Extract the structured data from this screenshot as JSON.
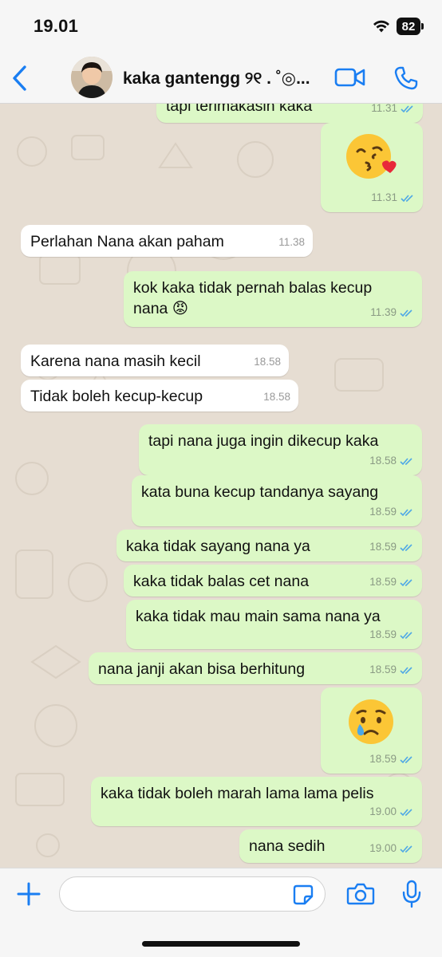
{
  "status_bar": {
    "time": "19.01",
    "battery": "82"
  },
  "header": {
    "contact_name": "kaka gantengg ୨୧ . ˚◎..."
  },
  "messages": [
    {
      "text": "tapi terimakasih kaka",
      "time": "11.31"
    },
    {
      "emoji": "kissing-face-with-heart",
      "time": "11.31"
    },
    {
      "text": "Perlahan Nana akan paham",
      "time": "11.38"
    },
    {
      "text": "kok kaka tidak pernah balas kecup nana 😡",
      "line1": "kok kaka tidak pernah balas kecup",
      "line2": "nana 😡",
      "time": "11.39"
    },
    {
      "text": "Karena nana masih kecil",
      "time": "18.58"
    },
    {
      "text": "Tidak boleh kecup-kecup",
      "time": "18.58"
    },
    {
      "text": "tapi nana juga ingin dikecup kaka",
      "time": "18.58"
    },
    {
      "text": "kata buna kecup tandanya sayang",
      "time": "18.59"
    },
    {
      "text": "kaka tidak sayang nana ya",
      "time": "18.59"
    },
    {
      "text": "kaka tidak balas cet nana",
      "time": "18.59"
    },
    {
      "text": "kaka tidak mau main sama nana ya",
      "time": "18.59"
    },
    {
      "text": "nana janji akan bisa berhitung",
      "time": "18.59"
    },
    {
      "emoji": "crying-face",
      "time": "18.59"
    },
    {
      "text": "kaka tidak boleh marah lama lama pelis",
      "time": "19.00"
    },
    {
      "text": "nana sedih",
      "time": "19.00"
    }
  ],
  "colors": {
    "outgoing_bubble": "#dcf8c6",
    "incoming_bubble": "#ffffff",
    "accent": "#1a7ef2",
    "chat_background": "#e6ddd2"
  },
  "icons": {
    "back": "chevron-left-icon",
    "video": "video-call-icon",
    "call": "phone-icon",
    "plus": "plus-icon",
    "sticker": "sticker-icon",
    "camera": "camera-icon",
    "mic": "microphone-icon"
  }
}
